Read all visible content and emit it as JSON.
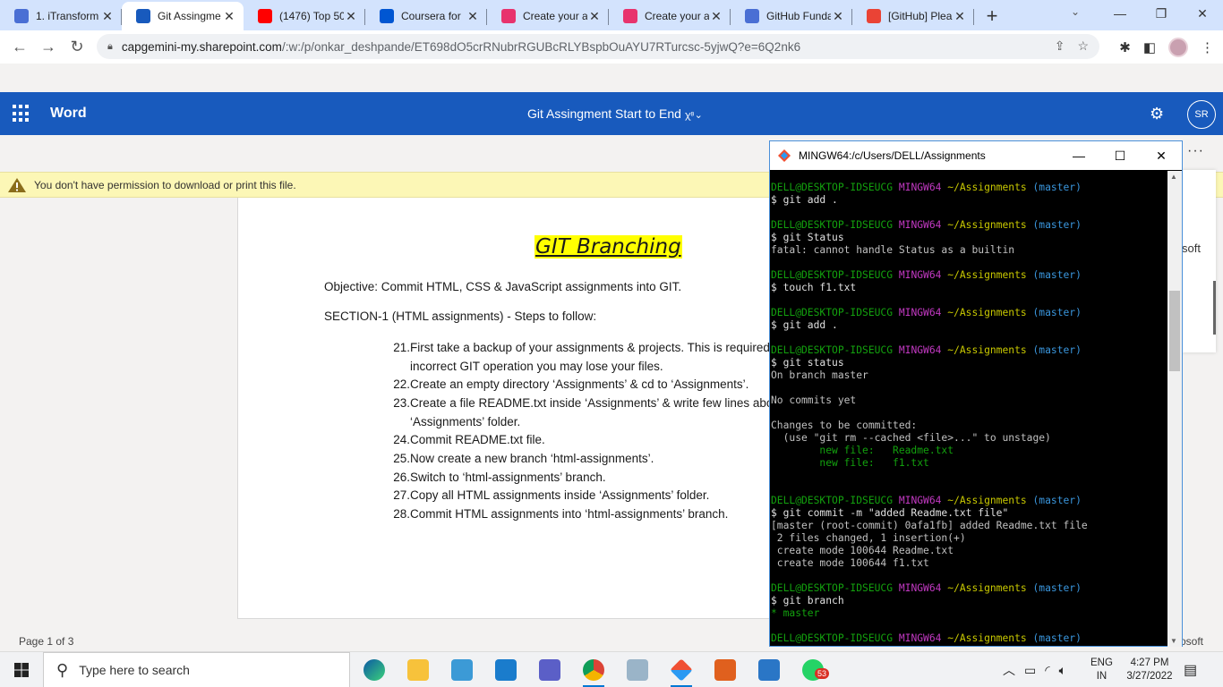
{
  "browser": {
    "tabs": [
      {
        "title": "1. iTransform",
        "icon": "link-icon",
        "color": "#4a6fd4"
      },
      {
        "title": "Git Assingme",
        "icon": "word-icon",
        "color": "#185abd",
        "active": true
      },
      {
        "title": "(1476) Top 50",
        "icon": "youtube-icon",
        "color": "#ff0000"
      },
      {
        "title": "Coursera for",
        "icon": "coursera-icon",
        "color": "#0056d2"
      },
      {
        "title": "Create your a",
        "icon": "record-icon",
        "color": "#e8336d"
      },
      {
        "title": "Create your a",
        "icon": "record-icon",
        "color": "#e8336d"
      },
      {
        "title": "GitHub Funda",
        "icon": "link-icon",
        "color": "#4a6fd4"
      },
      {
        "title": "[GitHub] Plea",
        "icon": "gmail-icon",
        "color": "#ea4335"
      }
    ],
    "new_tab": "+",
    "url_host": "capgemini-my.sharepoint.com",
    "url_path": "/:w:/p/onkar_deshpande/ET698dO5crRNubrRGUBcRLYBspbOuAYU7RTurcsc-5yjwQ?e=6Q2nk6"
  },
  "word": {
    "app_name": "Word",
    "doc_title": "Git Assingment Start to End",
    "avatar": "SR",
    "warning": "You don't have permission to download or print this file.",
    "more": "···",
    "side_text": "soft",
    "status_page": "Page 1 of 3",
    "status_right": "osoft"
  },
  "document": {
    "title": "GIT Branching",
    "objective": "Objective: Commit HTML, CSS & JavaScript assignments into GIT.",
    "section": "SECTION-1 (HTML assignments) - Steps to follow:",
    "steps": [
      {
        "num": "21.",
        "text": "First take a  backup of your assignments & projects. This is required"
      },
      {
        "num": "",
        "text": "incorrect GIT operation you may lose your files."
      },
      {
        "num": "22.",
        "text": "Create an empty directory ‘Assignments’ & cd to ‘Assignments’."
      },
      {
        "num": "23.",
        "text": "Create a file README.txt inside ‘Assignments’ & write few lines abo"
      },
      {
        "num": "",
        "text": "‘Assignments’ folder."
      },
      {
        "num": "24.",
        "text": "Commit README.txt file."
      },
      {
        "num": "25.",
        "text": "Now create a  new branch ‘html-assignments’."
      },
      {
        "num": "26.",
        "text": "Switch to ‘html-assignments’ branch."
      },
      {
        "num": "27.",
        "text": "Copy all HTML assignments inside ‘Assignments’ folder."
      },
      {
        "num": "28.",
        "text": "Commit HTML assignments into ‘html-assignments’ branch."
      }
    ]
  },
  "terminal": {
    "title": "MINGW64:/c/Users/DELL/Assignments",
    "prompt_user": "DELL@DESKTOP-IDSEUCG",
    "prompt_env": "MINGW64",
    "prompt_path": "~/Assignments",
    "prompt_branch": "(master)",
    "lines": [
      {
        "type": "prompt"
      },
      {
        "type": "cmd",
        "text": "$ git add ."
      },
      {
        "type": "blank"
      },
      {
        "type": "prompt"
      },
      {
        "type": "cmd",
        "text": "$ git Status"
      },
      {
        "type": "out",
        "text": "fatal: cannot handle Status as a builtin"
      },
      {
        "type": "blank"
      },
      {
        "type": "prompt"
      },
      {
        "type": "cmd",
        "text": "$ touch f1.txt"
      },
      {
        "type": "blank"
      },
      {
        "type": "prompt"
      },
      {
        "type": "cmd",
        "text": "$ git add ."
      },
      {
        "type": "blank"
      },
      {
        "type": "prompt"
      },
      {
        "type": "cmd",
        "text": "$ git status"
      },
      {
        "type": "out",
        "text": "On branch master"
      },
      {
        "type": "blank"
      },
      {
        "type": "out",
        "text": "No commits yet"
      },
      {
        "type": "blank"
      },
      {
        "type": "out",
        "text": "Changes to be committed:"
      },
      {
        "type": "out",
        "text": "  (use \"git rm --cached <file>...\" to unstage)"
      },
      {
        "type": "green",
        "text": "        new file:   Readme.txt"
      },
      {
        "type": "green",
        "text": "        new file:   f1.txt"
      },
      {
        "type": "blank"
      },
      {
        "type": "blank"
      },
      {
        "type": "prompt"
      },
      {
        "type": "cmd",
        "text": "$ git commit -m \"added Readme.txt file\""
      },
      {
        "type": "out",
        "text": "[master (root-commit) 0afa1fb] added Readme.txt file"
      },
      {
        "type": "out",
        "text": " 2 files changed, 1 insertion(+)"
      },
      {
        "type": "out",
        "text": " create mode 100644 Readme.txt"
      },
      {
        "type": "out",
        "text": " create mode 100644 f1.txt"
      },
      {
        "type": "blank"
      },
      {
        "type": "prompt"
      },
      {
        "type": "cmd",
        "text": "$ git branch"
      },
      {
        "type": "green",
        "text": "* master"
      },
      {
        "type": "blank"
      },
      {
        "type": "prompt"
      }
    ]
  },
  "taskbar": {
    "search_placeholder": "Type here to search",
    "lang_top": "ENG",
    "lang_bottom": "IN",
    "time": "4:27 PM",
    "date": "3/27/2022",
    "whatsapp_badge": "53"
  }
}
